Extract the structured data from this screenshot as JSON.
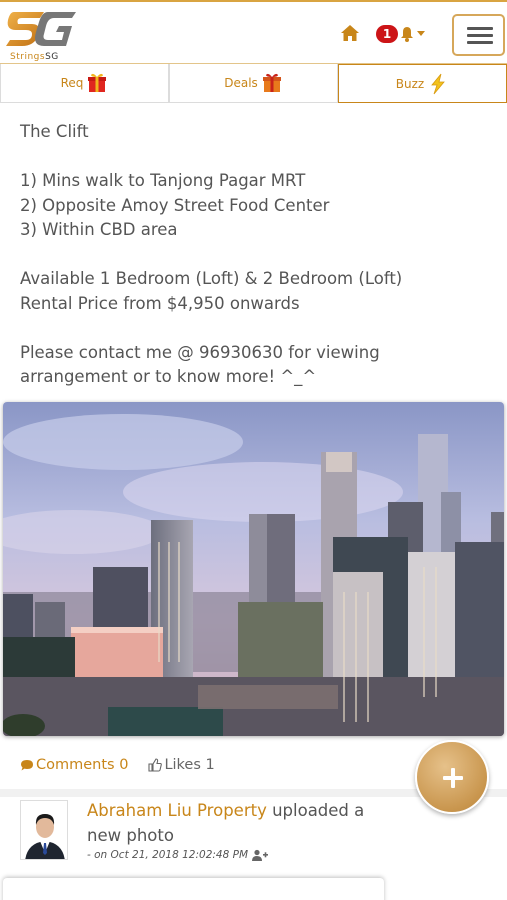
{
  "app": {
    "logo_mark": "SG",
    "logo_text_brand": "Strings",
    "logo_text_suffix": "SG"
  },
  "header": {
    "home_icon": "home-icon",
    "notification_count": "1",
    "bell_icon": "bell-icon",
    "menu_icon": "hamburger-icon"
  },
  "tabs": [
    {
      "label": "Req",
      "icon": "gift-box-icon"
    },
    {
      "label": "Deals",
      "icon": "gift-box-icon"
    },
    {
      "label": "Buzz",
      "icon": "lightning-icon"
    }
  ],
  "post": {
    "body": "The Clift\n\n1) Mins walk to Tanjong Pagar MRT\n2) Opposite Amoy Street Food Center\n3) Within CBD area\n\nAvailable 1 Bedroom (Loft) & 2 Bedroom (Loft)\nRental Price from $4,950 onwards\n\nPlease contact me @ 96930630 for viewing arrangement or to know more! ^_^",
    "comments_label": "Comments 0",
    "likes_label": "Likes 1"
  },
  "next_post": {
    "author": "Abraham Liu Property",
    "action": " uploaded a new photo",
    "meta": "- on Oct 21, 2018 12:02:48 PM"
  },
  "colors": {
    "accent": "#c8861a",
    "badge": "#cc1417",
    "border": "#d9a441"
  }
}
